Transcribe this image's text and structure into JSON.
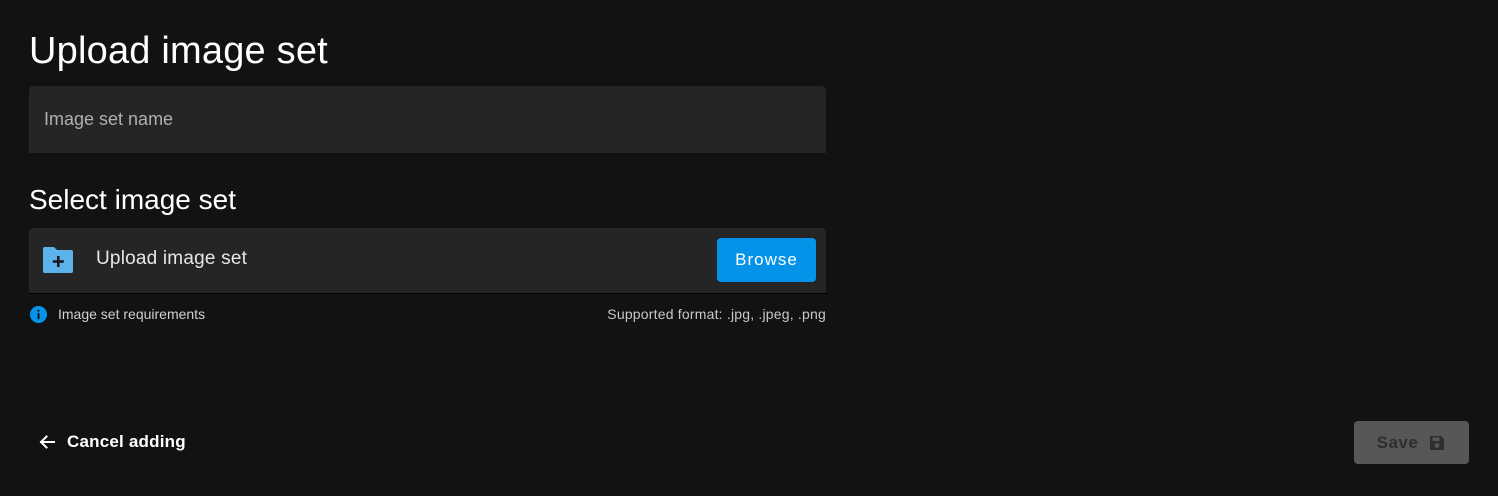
{
  "page": {
    "title": "Upload image set"
  },
  "name_field": {
    "placeholder": "Image set name",
    "value": ""
  },
  "select_section": {
    "title": "Select image set",
    "upload_label": "Upload image set",
    "upload_icon": "folder-plus-icon",
    "browse_label": "Browse",
    "requirements_label": "Image set requirements",
    "requirements_icon": "info-icon",
    "supported_formats": "Supported format: .jpg, .jpeg, .png"
  },
  "footer": {
    "cancel_label": "Cancel adding",
    "cancel_icon": "arrow-left-icon",
    "save_label": "Save",
    "save_icon": "floppy-disk-icon"
  },
  "colors": {
    "background": "#121212",
    "field_background": "#252525",
    "accent": "#0593ea",
    "disabled_button": "#575757"
  }
}
